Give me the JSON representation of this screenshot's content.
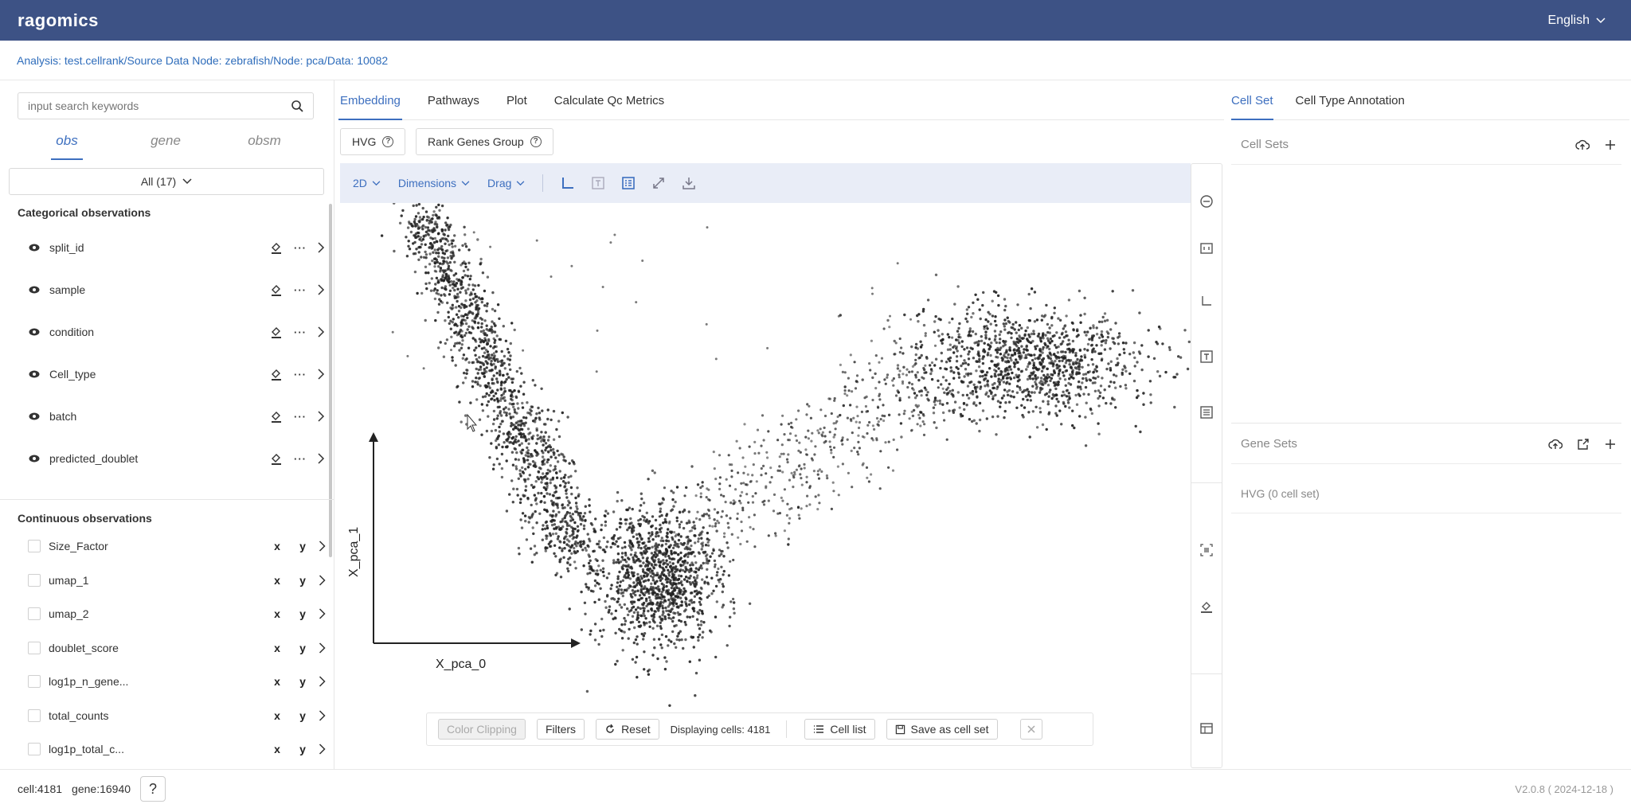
{
  "app": {
    "logo": "ragomics",
    "language": "English"
  },
  "breadcrumb": "Analysis: test.cellrank/Source Data Node: zebrafish/Node: pca/Data: 10082",
  "left": {
    "search_placeholder": "input search keywords",
    "tabs": [
      "obs",
      "gene",
      "obsm"
    ],
    "filter": "All (17)",
    "categorical_title": "Categorical observations",
    "categorical": [
      "split_id",
      "sample",
      "condition",
      "Cell_type",
      "batch",
      "predicted_doublet"
    ],
    "continuous_title": "Continuous observations",
    "continuous": [
      "Size_Factor",
      "umap_1",
      "umap_2",
      "doublet_score",
      "log1p_n_gene...",
      "total_counts",
      "log1p_total_c..."
    ],
    "x_label": "x",
    "y_label": "y"
  },
  "center": {
    "tabs": [
      "Embedding",
      "Pathways",
      "Plot",
      "Calculate Qc Metrics"
    ],
    "buttons": {
      "hvg": "HVG",
      "rank": "Rank Genes Group"
    },
    "toolbar": {
      "mode": "2D",
      "dimensions": "Dimensions",
      "drag": "Drag"
    },
    "axis": {
      "x": "X_pca_0",
      "y": "X_pca_1"
    },
    "bottom": {
      "color_clipping": "Color Clipping",
      "filters": "Filters",
      "reset": "Reset",
      "displaying": "Displaying cells: 4181",
      "cell_list": "Cell list",
      "save": "Save as cell set"
    }
  },
  "right": {
    "tabs": [
      "Cell Set",
      "Cell Type Annotation"
    ],
    "cell_sets": "Cell Sets",
    "gene_sets": "Gene Sets",
    "hvg": "HVG (0 cell set)"
  },
  "footer": {
    "cells": "cell:4181",
    "genes": "gene:16940",
    "help": "?",
    "version": "V2.0.8 ( 2024-12-18 )"
  },
  "colors": {
    "header": "#3d5285",
    "accent": "#3d6fbf",
    "toolbar": "#e9edf7"
  },
  "chart_data": {
    "type": "scatter",
    "xlabel": "X_pca_0",
    "ylabel": "X_pca_1",
    "point_count": 4181,
    "description_clusters": [
      {
        "x": 0.15,
        "y": 0.88
      },
      {
        "x": 0.3,
        "y": 0.6
      },
      {
        "x": 0.4,
        "y": 0.25
      },
      {
        "x": 0.8,
        "y": 0.62
      }
    ]
  }
}
